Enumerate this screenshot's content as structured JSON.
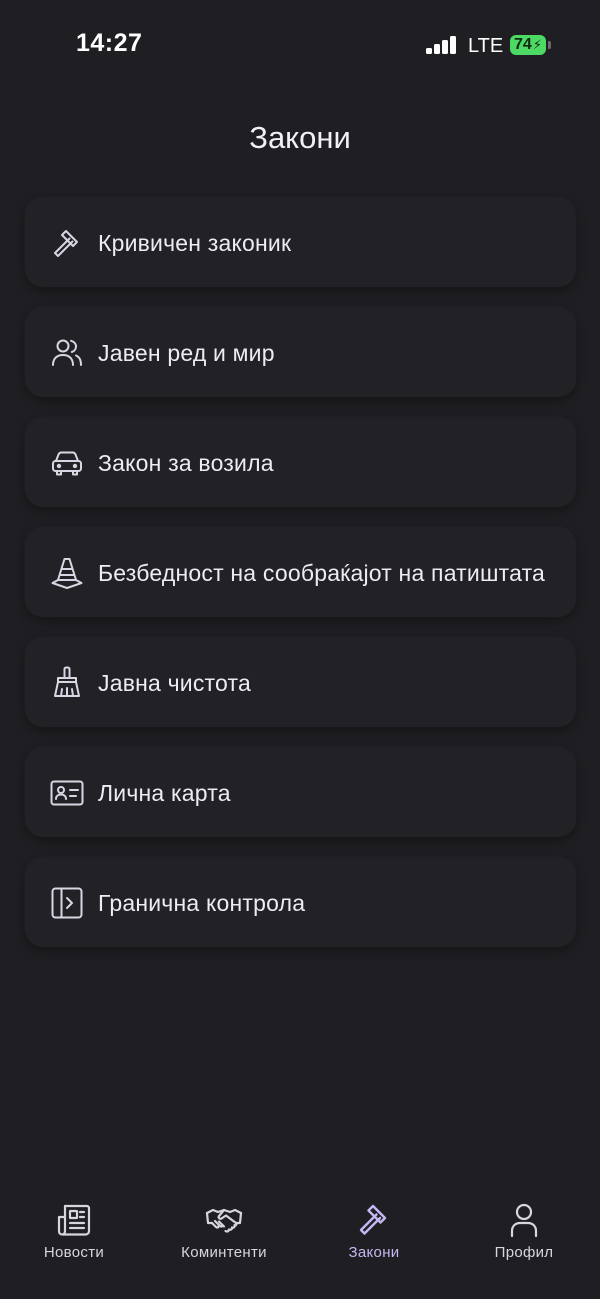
{
  "status_bar": {
    "time": "14:27",
    "network": "LTE",
    "battery": "74"
  },
  "page": {
    "title": "Закони"
  },
  "laws": [
    {
      "label": "Кривичен законик",
      "icon": "gavel-icon"
    },
    {
      "label": "Јавен ред и мир",
      "icon": "users-icon"
    },
    {
      "label": "Закон за возила",
      "icon": "car-icon"
    },
    {
      "label": "Безбедност на сообраќајот на патиштата",
      "icon": "traffic-cone-icon"
    },
    {
      "label": "Јавна чистота",
      "icon": "broom-icon"
    },
    {
      "label": "Лична карта",
      "icon": "id-card-icon"
    },
    {
      "label": "Гранична контрола",
      "icon": "border-panel-icon"
    }
  ],
  "tabs": [
    {
      "label": "Новости",
      "icon": "newspaper-icon",
      "active": false
    },
    {
      "label": "Коминтенти",
      "icon": "handshake-icon",
      "active": false
    },
    {
      "label": "Закони",
      "icon": "gavel-icon",
      "active": true
    },
    {
      "label": "Профил",
      "icon": "user-icon",
      "active": false
    }
  ],
  "colors": {
    "background": "#1f1e22",
    "card": "#222125",
    "icon_stroke": "#d9d5e3",
    "active_tab": "#c5b7f2",
    "battery": "#4cd964"
  }
}
